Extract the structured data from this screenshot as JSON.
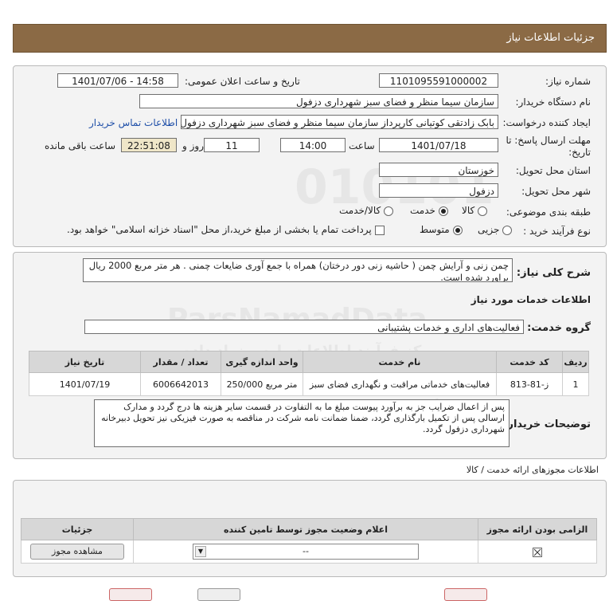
{
  "header": {
    "title": "جزئیات اطلاعات نیاز"
  },
  "form": {
    "need_number_label": "شماره نیاز:",
    "need_number": "1101095591000002",
    "announce_label": "تاریخ و ساعت اعلان عمومی:",
    "announce_value": "1401/07/06 - 14:58",
    "buyer_label": "نام دستگاه خریدار:",
    "buyer_value": "سازمان سیما منظر و فضای سبز شهرداری دزفول",
    "creator_label": "ایجاد کننده درخواست:",
    "creator_value": "بابک زادتقی کوتیانی کارپرداز سازمان سیما منظر و فضای سبز شهرداری دزفول",
    "contact_link": "اطلاعات تماس خریدار",
    "deadline_label_1": "مهلت ارسال پاسخ: تا",
    "deadline_label_2": "تاریخ:",
    "deadline_date": "1401/07/18",
    "time_label": "ساعت",
    "deadline_time": "14:00",
    "days_value": "11",
    "days_label": "روز و",
    "remaining_time": "22:51:08",
    "remaining_label": "ساعت باقی مانده",
    "province_label": "استان محل تحویل:",
    "province_value": "خوزستان",
    "city_label": "شهر محل تحویل:",
    "city_value": "دزفول",
    "category_label": "طبقه بندی موضوعی:",
    "category_options": [
      "کالا",
      "خدمت",
      "کالا/خدمت"
    ],
    "category_selected": "خدمت",
    "process_label": "نوع فرآیند خرید :",
    "process_options": [
      "جزیی",
      "متوسط"
    ],
    "process_selected": "متوسط",
    "payment_text": "پرداخت تمام یا بخشی از مبلغ خرید،از محل \"اسناد خزانه اسلامی\" خواهد بود."
  },
  "summary": {
    "label": "شرح کلی نیاز:",
    "text": "چمن زنی و آرایش چمن ( حاشیه زنی دور درختان) همراه با جمع آوری ضایعات چمنی . هر متر مربع 2000 ریال براورد شده است."
  },
  "services": {
    "section_title": "اطلاعات خدمات مورد نیاز",
    "group_label": "گروه خدمت:",
    "group_value": "فعالیت‌های اداری و خدمات پشتیبانی",
    "columns": [
      "ردیف",
      "کد خدمت",
      "نام خدمت",
      "واحد اندازه گیری",
      "تعداد / مقدار",
      "تاریخ نیاز"
    ],
    "rows": [
      [
        "1",
        "ز-81-813",
        "فعالیت‌های خدماتی مراقبت و نگهداری فضای سبز",
        "متر مربع 250/000",
        "6006642013",
        "1401/07/19"
      ]
    ]
  },
  "buyer_notes": {
    "label": "توضیحات خریدار:",
    "text": "پس از اعمال ضرایب جز به برآورد پیوست مبلغ ما به التفاوت در قسمت سایر هزینه ها درج گردد و مدارک ارسالی پس از تکمیل بارگذاری گردد، ضمنا ضمانت نامه شرکت در مناقصه به صورت فیزیکی نیز تحویل دبیرخانه شهرداری دزفول گردد."
  },
  "permits": {
    "section_title": "اطلاعات مجوزهای ارائه خدمت / کالا",
    "columns": [
      "الزامی بودن ارائه مجوز",
      "اعلام وضعیت مجوز توسط تامین کننده",
      "جزئیات"
    ],
    "status_value": "--",
    "view_button": "مشاهده مجوز"
  },
  "watermark": {
    "brand": "ParsNamadData",
    "tagline_1": "مرکز فرآیند اطلاعات پارس نماد داده",
    "tagline_2": "پایگاه خبری رسانی مناقصه و مزایده",
    "code": "010101"
  }
}
